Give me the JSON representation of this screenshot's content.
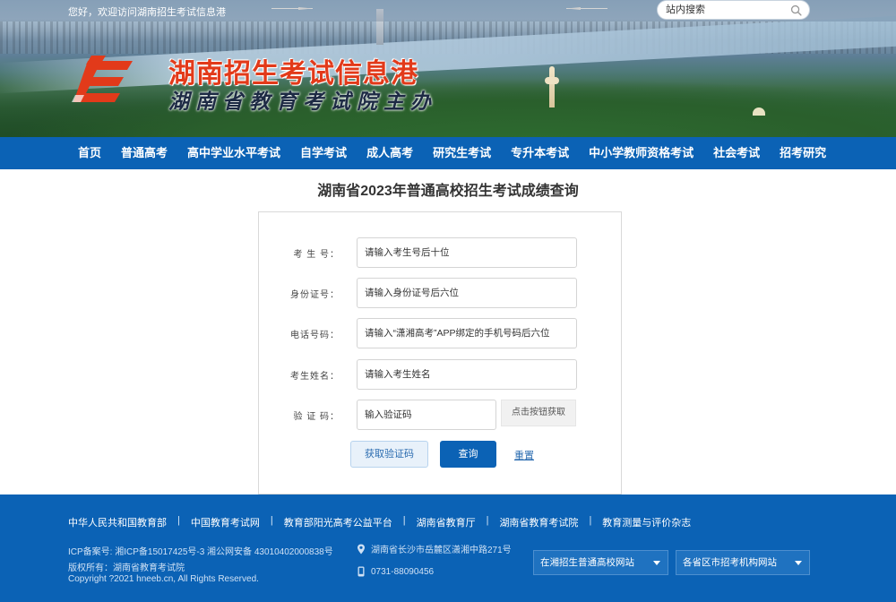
{
  "header": {
    "welcome": "您好，欢迎访问湖南招生考试信息港",
    "search_placeholder": "站内搜索",
    "site_title": "湖南招生考试信息港",
    "site_subtitle": "湖南省教育考试院主办"
  },
  "nav": {
    "items": [
      "首页",
      "普通高考",
      "高中学业水平考试",
      "自学考试",
      "成人高考",
      "研究生考试",
      "专升本考试",
      "中小学教师资格考试",
      "社会考试",
      "招考研究"
    ]
  },
  "page": {
    "title": "湖南省2023年普通高校招生考试成绩查询"
  },
  "form": {
    "exam_no": {
      "label": "考 生 号：",
      "placeholder": "请输入考生号后十位"
    },
    "id_no": {
      "label": "身份证号：",
      "placeholder": "请输入身份证号后六位"
    },
    "phone": {
      "label": "电话号码：",
      "placeholder": "请输入“潇湘高考”APP绑定的手机号码后六位"
    },
    "name": {
      "label": "考生姓名：",
      "placeholder": "请输入考生姓名"
    },
    "captcha": {
      "label": "验 证 码：",
      "placeholder": "输入验证码",
      "hint": "点击按钮获取"
    },
    "get_code_button": "获取验证码",
    "query_button": "查询",
    "reset_link": "重置"
  },
  "footer": {
    "links": [
      "中华人民共和国教育部",
      "中国教育考试网",
      "教育部阳光高考公益平台",
      "湖南省教育厅",
      "湖南省教育考试院",
      "教育测量与评价杂志"
    ],
    "icp": "ICP备案号: 湘ICP备15017425号-3 湘公网安备 43010402000838号",
    "copyright_owner": "版权所有：湖南省教育考试院",
    "copyright": "Copyright ?2021 hneeb.cn, All Rights Reserved.",
    "address": "湖南省长沙市岳麓区潇湘中路271号",
    "phone": "0731-88090456",
    "select1": "在湘招生普通高校网站",
    "select2": "各省区市招考机构网站"
  },
  "colors": {
    "primary": "#0b62b5",
    "title_red": "#e23a1a",
    "link": "#2b6cb0"
  },
  "icons": [
    "search-icon",
    "logo-icon",
    "location-icon",
    "phone-icon",
    "caret-down-icon"
  ]
}
